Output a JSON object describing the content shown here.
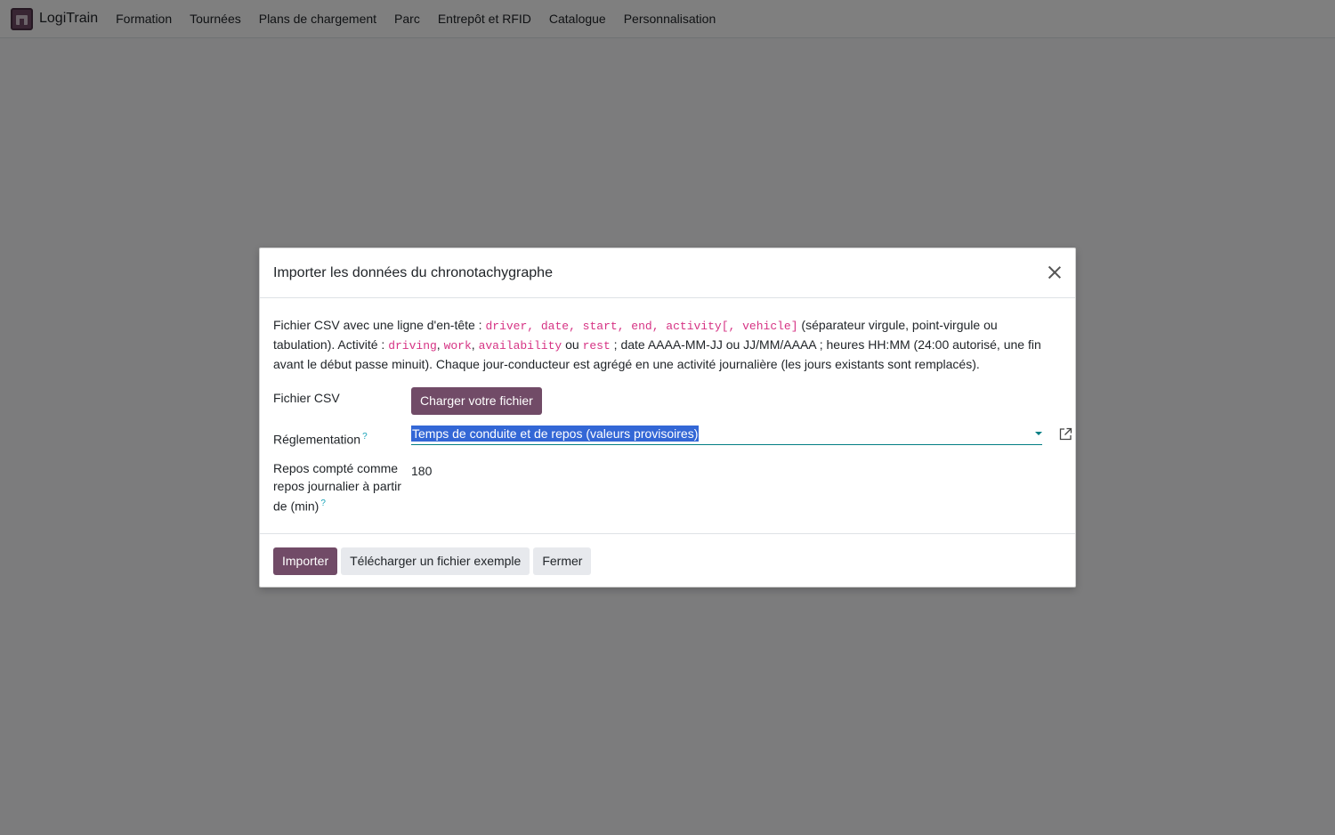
{
  "navbar": {
    "brand": "LogiTrain",
    "menu": [
      {
        "label": "Formation"
      },
      {
        "label": "Tournées"
      },
      {
        "label": "Plans de chargement"
      },
      {
        "label": "Parc"
      },
      {
        "label": "Entrepôt et RFID"
      },
      {
        "label": "Catalogue"
      },
      {
        "label": "Personnalisation"
      }
    ]
  },
  "dialog": {
    "title": "Importer les données du chronotachygraphe",
    "description": {
      "part1": "Fichier CSV avec une ligne d'en-tête : ",
      "code_header": "driver, date, start, end, activity[, vehicle]",
      "part2": " (séparateur virgule, point-virgule ou tabulation). Activité : ",
      "code_driving": "driving",
      "sep1": ", ",
      "code_work": "work",
      "sep2": ", ",
      "code_availability": "availability",
      "part3": " ou ",
      "code_rest": "rest",
      "part4": " ; date AAAA-MM-JJ ou JJ/MM/AAAA ; heures HH:MM (24:00 autorisé, une fin avant le début passe minuit). Chaque jour-conducteur est agrégé en une activité journalière (les jours existants sont remplacés)."
    },
    "fields": {
      "csv_label": "Fichier CSV",
      "upload_button": "Charger votre fichier",
      "regulation_label": "Réglementation",
      "regulation_help": "?",
      "regulation_value": "Temps de conduite et de repos (valeurs provisoires)",
      "rest_label": "Repos compté comme repos journalier à partir de (min)",
      "rest_help": "?",
      "rest_value": "180"
    },
    "footer": {
      "import_button": "Importer",
      "download_button": "Télécharger un fichier exemple",
      "close_button": "Fermer"
    }
  },
  "colors": {
    "primary": "#714B67",
    "accent": "#017e84",
    "code": "#d63384",
    "help": "#17a2b8",
    "selection": "#3367d6"
  }
}
